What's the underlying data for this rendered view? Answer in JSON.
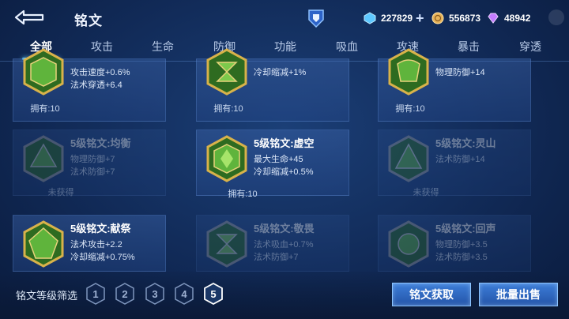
{
  "header": {
    "title": "铭文",
    "currencies": [
      {
        "name": "diamond",
        "value": "227829",
        "color": "#5ec8ff"
      },
      {
        "name": "gold",
        "value": "556873",
        "color": "#e8b45a"
      },
      {
        "name": "gem",
        "value": "48942",
        "color": "#c37cff"
      }
    ],
    "plus_label": "+"
  },
  "tabs": [
    "全部",
    "攻击",
    "生命",
    "防御",
    "功能",
    "吸血",
    "攻速",
    "暴击",
    "穿透"
  ],
  "active_tab": 0,
  "cards": [
    {
      "name": "",
      "attrs": [
        "攻击速度+0.6%",
        "法术穿透+6.4"
      ],
      "owned": "拥有:10",
      "dim": false
    },
    {
      "name": "",
      "attrs": [
        "冷却缩减+1%"
      ],
      "owned": "拥有:10",
      "dim": false
    },
    {
      "name": "",
      "attrs": [
        "物理防御+14"
      ],
      "owned": "拥有:10",
      "dim": false
    },
    {
      "name": "5级铭文:均衡",
      "attrs": [
        "物理防御+7",
        "法术防御+7"
      ],
      "owned": "未获得",
      "dim": true
    },
    {
      "name": "5级铭文:虚空",
      "attrs": [
        "最大生命+45",
        "冷却缩减+0.5%"
      ],
      "owned": "拥有:10",
      "dim": false
    },
    {
      "name": "5级铭文:灵山",
      "attrs": [
        "法术防御+14"
      ],
      "owned": "未获得",
      "dim": true
    },
    {
      "name": "5级铭文:献祭",
      "attrs": [
        "法术攻击+2.2",
        "冷却缩减+0.75%"
      ],
      "owned": "",
      "dim": false
    },
    {
      "name": "5级铭文:敬畏",
      "attrs": [
        "法术吸血+0.7%",
        "法术防御+7"
      ],
      "owned": "",
      "dim": true
    },
    {
      "name": "5级铭文:回声",
      "attrs": [
        "物理防御+3.5",
        "法术防御+3.5"
      ],
      "owned": "",
      "dim": true
    }
  ],
  "filter": {
    "label": "铭文等级筛选",
    "levels": [
      "1",
      "2",
      "3",
      "4",
      "5"
    ],
    "selected": 4
  },
  "buttons": {
    "acquire": "铭文获取",
    "sell": "批量出售"
  },
  "colors": {
    "accent": "#6fd3ff",
    "emblem_green": "#4fa83a",
    "emblem_gold": "#d8b24a"
  }
}
